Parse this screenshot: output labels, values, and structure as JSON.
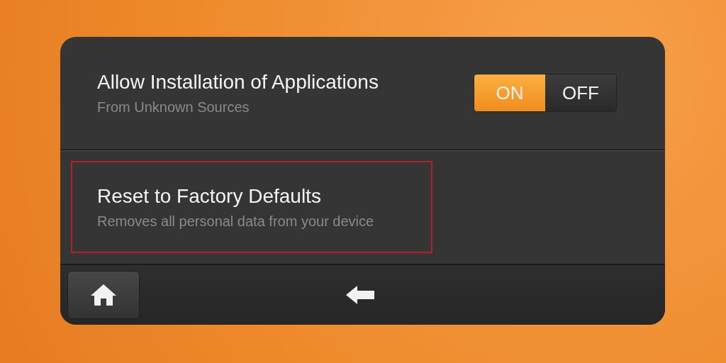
{
  "settings": [
    {
      "kind": "toggle",
      "title": "Allow Installation of Applications",
      "subtitle": "From Unknown Sources",
      "highlighted": false,
      "options": [
        {
          "label": "ON",
          "selected": true
        },
        {
          "label": "OFF",
          "selected": false
        }
      ]
    },
    {
      "kind": "action",
      "title": "Reset to Factory Defaults",
      "subtitle": "Removes all personal data from your device",
      "highlighted": true
    }
  ]
}
